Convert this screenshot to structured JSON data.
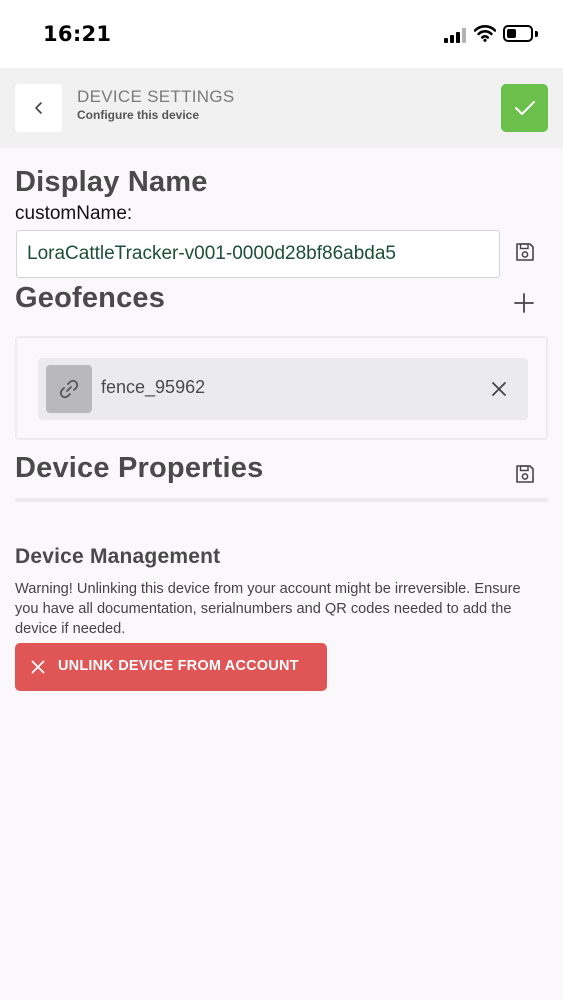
{
  "status_bar": {
    "time": "16:21"
  },
  "header": {
    "title": "DEVICE SETTINGS",
    "subtitle": "Configure this device"
  },
  "display_name": {
    "section_title": "Display Name",
    "field_label": "customName:",
    "value": "LoraCattleTracker-v001-0000d28bf86abda5"
  },
  "geofences": {
    "section_title": "Geofences",
    "items": [
      {
        "name": "fence_95962"
      }
    ]
  },
  "device_properties": {
    "section_title": "Device Properties"
  },
  "device_management": {
    "title": "Device Management",
    "warning": "Warning! Unlinking this device from your account might be irreversible. Ensure you have all documentation, serialnumbers and QR codes needed to add the device if needed.",
    "unlink_label": "UNLINK DEVICE FROM ACCOUNT"
  },
  "colors": {
    "confirm": "#6bbf4b",
    "danger": "#e05555",
    "input_text": "#1d4e3a"
  }
}
